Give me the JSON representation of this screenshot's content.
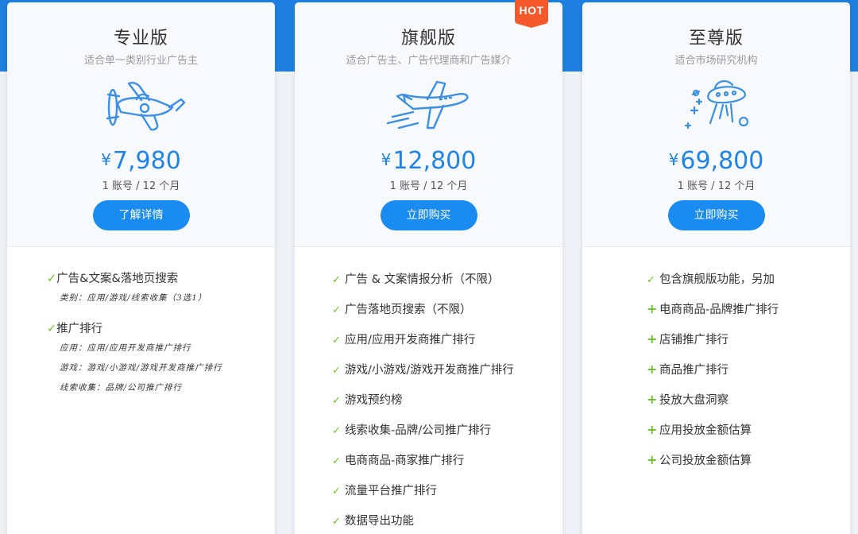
{
  "colors": {
    "accent": "#1a8bf0",
    "price": "#1f84e6",
    "hot": "#f4592b",
    "check": "#6cbf2e"
  },
  "plans": [
    {
      "name": "专业版",
      "subtitle": "适合单一类别行业广告主",
      "icon": "propeller-plane-icon",
      "currency": "¥",
      "price": "7,980",
      "period": "1 账号 / 12 个月",
      "button": "了解详情",
      "groups": [
        {
          "label": "广告&文案&落地页搜索",
          "subs": [
            "类别：应用/游戏/线索收集（3选1）"
          ]
        },
        {
          "label": "推广排行",
          "subs": [
            "应用：应用/应用开发商推广排行",
            "游戏：游戏/小游戏/游戏开发商推广排行",
            "线索收集：品牌/公司推广排行"
          ]
        }
      ]
    },
    {
      "name": "旗舰版",
      "subtitle": "适合广告主、广告代理商和广告媒介",
      "icon": "jet-plane-icon",
      "badge": "HOT",
      "currency": "¥",
      "price": "12,800",
      "period": "1 账号 / 12 个月",
      "button": "立即购买",
      "features": [
        "广告 & 文案情报分析（不限）",
        "广告落地页搜索（不限）",
        "应用/应用开发商推广排行",
        "游戏/小游戏/游戏开发商推广排行",
        "游戏预约榜",
        "线索收集-品牌/公司推广排行",
        "电商商品-商家推广排行",
        "流量平台推广排行",
        "数据导出功能"
      ]
    },
    {
      "name": "至尊版",
      "subtitle": "适合市场研究机构",
      "icon": "ufo-icon",
      "currency": "¥",
      "price": "69,800",
      "period": "1 账号 / 12 个月",
      "button": "立即购买",
      "features": [
        {
          "mark": "check",
          "text": "包含旗舰版功能，另加"
        },
        {
          "mark": "plus",
          "text": "电商商品-品牌推广排行"
        },
        {
          "mark": "plus",
          "text": "店铺推广排行"
        },
        {
          "mark": "plus",
          "text": "商品推广排行"
        },
        {
          "mark": "plus",
          "text": "投放大盘洞察"
        },
        {
          "mark": "plus",
          "text": "应用投放金额估算"
        },
        {
          "mark": "plus",
          "text": "公司投放金额估算"
        }
      ]
    }
  ]
}
